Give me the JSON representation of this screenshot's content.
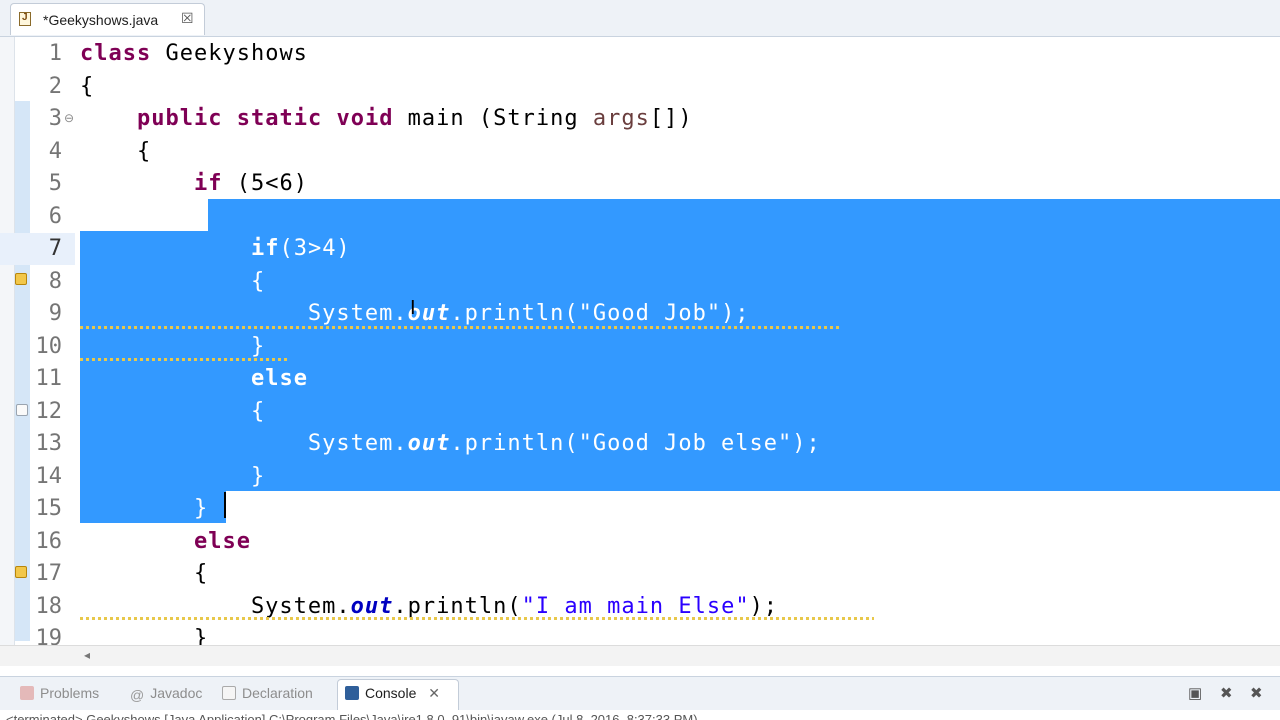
{
  "tab": {
    "title": "*Geekyshows.java",
    "close": "☒"
  },
  "code_lines": [
    {
      "n": "1",
      "tokens": [
        {
          "t": "class",
          "c": "kw"
        },
        {
          "t": " Geekyshows"
        }
      ]
    },
    {
      "n": "2",
      "tokens": [
        {
          "t": "{"
        }
      ]
    },
    {
      "n": "3",
      "fold": "⊖",
      "tokens": [
        {
          "t": "    "
        },
        {
          "t": "public",
          "c": "kw"
        },
        {
          "t": " "
        },
        {
          "t": "static",
          "c": "kw"
        },
        {
          "t": " "
        },
        {
          "t": "void",
          "c": "kw"
        },
        {
          "t": " main (String "
        },
        {
          "t": "args",
          "c": "par"
        },
        {
          "t": "[])"
        }
      ]
    },
    {
      "n": "4",
      "tokens": [
        {
          "t": "    {"
        }
      ]
    },
    {
      "n": "5",
      "tokens": [
        {
          "t": "        "
        },
        {
          "t": "if",
          "c": "kw"
        },
        {
          "t": " (5<6)"
        }
      ]
    },
    {
      "n": "6",
      "tokens": [
        {
          "t": "        {"
        }
      ]
    },
    {
      "n": "7",
      "tokens": [
        {
          "t": "            "
        },
        {
          "t": "if",
          "c": "kw"
        },
        {
          "t": "(3>4)"
        }
      ]
    },
    {
      "n": "8",
      "tokens": [
        {
          "t": "            {"
        }
      ]
    },
    {
      "n": "9",
      "tokens": [
        {
          "t": "                System."
        },
        {
          "t": "out",
          "c": "fld"
        },
        {
          "t": ".println("
        },
        {
          "t": "\"Good Job\"",
          "c": "str"
        },
        {
          "t": ");"
        }
      ]
    },
    {
      "n": "10",
      "tokens": [
        {
          "t": "            }"
        }
      ]
    },
    {
      "n": "11",
      "tokens": [
        {
          "t": "            "
        },
        {
          "t": "else",
          "c": "kw"
        }
      ]
    },
    {
      "n": "12",
      "tokens": [
        {
          "t": "            {"
        }
      ]
    },
    {
      "n": "13",
      "tokens": [
        {
          "t": "                System."
        },
        {
          "t": "out",
          "c": "fld"
        },
        {
          "t": ".println("
        },
        {
          "t": "\"Good Job else\"",
          "c": "str"
        },
        {
          "t": ");"
        }
      ]
    },
    {
      "n": "14",
      "tokens": [
        {
          "t": "            }"
        }
      ]
    },
    {
      "n": "15",
      "tokens": [
        {
          "t": "        }"
        }
      ]
    },
    {
      "n": "16",
      "tokens": [
        {
          "t": "        "
        },
        {
          "t": "else",
          "c": "kw"
        }
      ]
    },
    {
      "n": "17",
      "tokens": [
        {
          "t": "        {"
        }
      ]
    },
    {
      "n": "18",
      "tokens": [
        {
          "t": "            System."
        },
        {
          "t": "out",
          "c": "fld"
        },
        {
          "t": ".println("
        },
        {
          "t": "\"I am main Else\"",
          "c": "str"
        },
        {
          "t": ");"
        }
      ]
    },
    {
      "n": "19",
      "tokens": [
        {
          "t": "        }"
        }
      ]
    }
  ],
  "current_line": "7",
  "selected_lines": [
    "7",
    "8",
    "9",
    "10",
    "11",
    "12",
    "13",
    "14"
  ],
  "views": {
    "problems": "Problems",
    "javadoc": "Javadoc",
    "declaration": "Declaration",
    "console": "Console"
  },
  "console_text": "<terminated> Geekyshows [Java Application] C:\\Program Files\\Java\\jre1.8.0_91\\bin\\javaw.exe (Jul 8, 2016, 8:37:33 PM)",
  "colors": {
    "selection": "#3399ff",
    "keyword": "#7f0055",
    "string": "#2a00ff",
    "field": "#0000c0"
  }
}
